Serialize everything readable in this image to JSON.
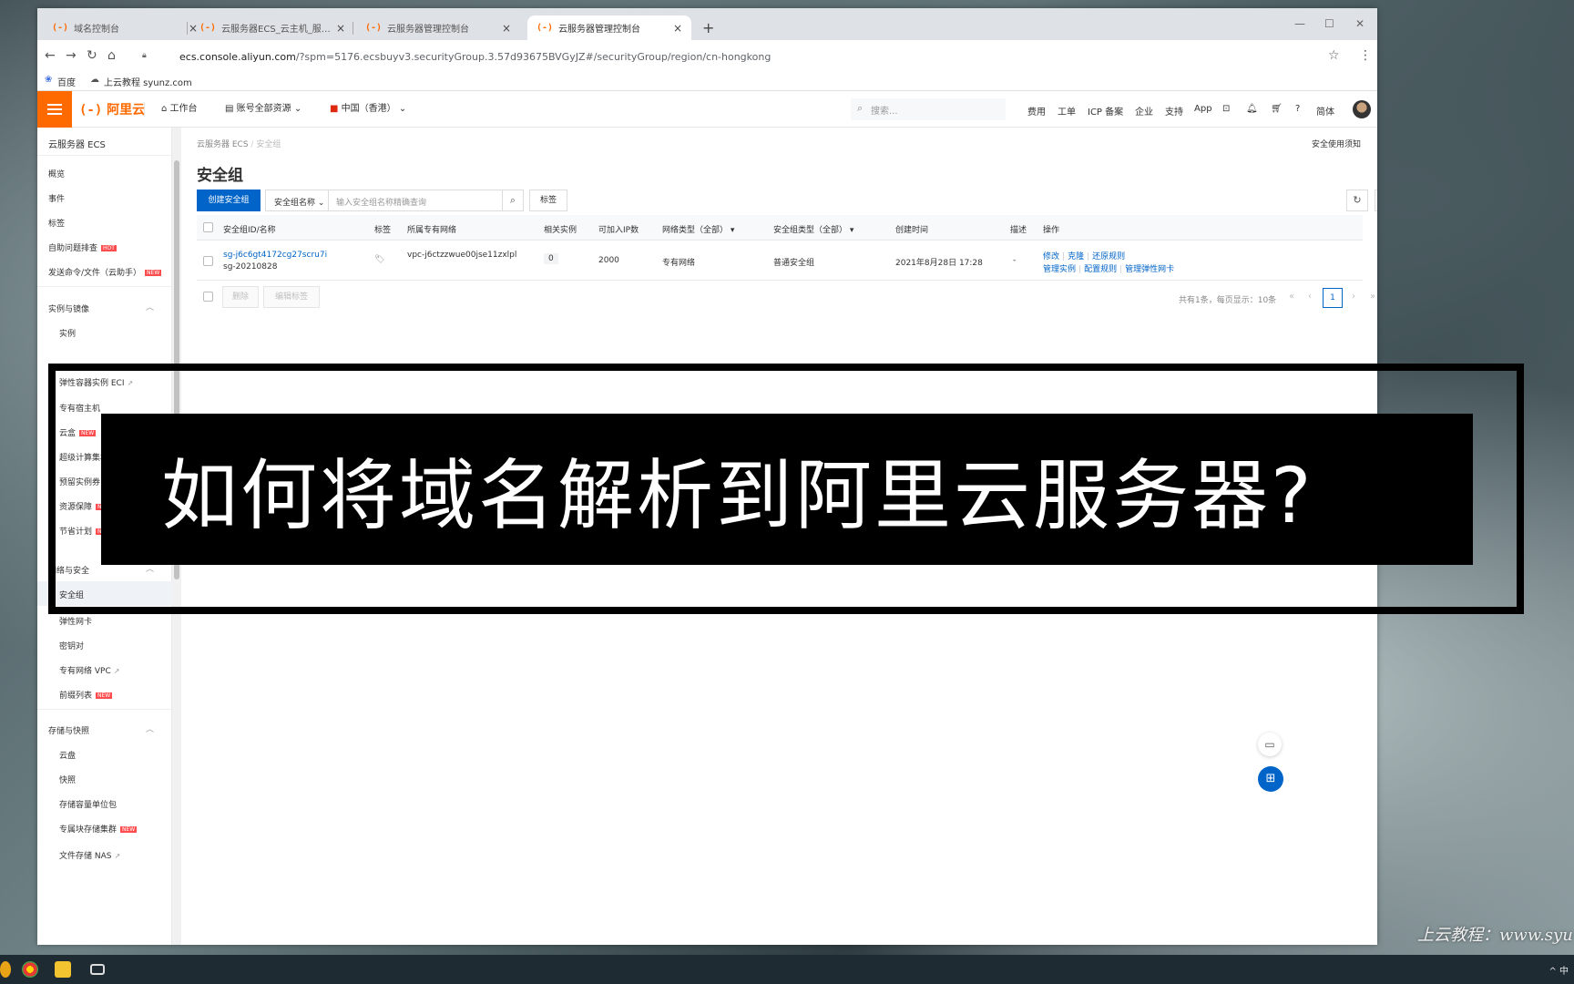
{
  "browser": {
    "tabs": [
      {
        "title": "域名控制台",
        "favicon": "(-)"
      },
      {
        "title": "云服务器ECS_云主机_服务器托管",
        "favicon": "(-)"
      },
      {
        "title": "云服务器管理控制台",
        "favicon": "(-)"
      },
      {
        "title": "云服务器管理控制台",
        "favicon": "(-)",
        "active": true
      }
    ],
    "url_host": "ecs.console.aliyun.com",
    "url_rest": "/?spm=5176.ecsbuyv3.securityGroup.3.57d93675BVGyJZ#/securityGroup/region/cn-hongkong",
    "bookmarks": [
      "百度",
      "上云教程 syunz.com"
    ]
  },
  "header": {
    "logo": "阿里云",
    "workbench": "工作台",
    "account_resources": "账号全部资源",
    "region": "中国（香港）",
    "search_placeholder": "搜索...",
    "links": [
      "费用",
      "工单",
      "ICP 备案",
      "企业",
      "支持",
      "App"
    ],
    "lang": "简体"
  },
  "sidebar": {
    "title": "云服务器 ECS",
    "top_items": [
      {
        "label": "概览"
      },
      {
        "label": "事件"
      },
      {
        "label": "标签"
      },
      {
        "label": "自助问题排查",
        "badge": "HOT"
      },
      {
        "label": "发送命令/文件（云助手）",
        "badge": "NEW"
      }
    ],
    "group1": {
      "title": "实例与镜像",
      "items": [
        {
          "label": "实例"
        }
      ]
    },
    "hidden_items": [
      {
        "label": "弹性容器实例 ECI",
        "ext": true
      },
      {
        "label": "专有宿主机"
      },
      {
        "label": "云盒",
        "badge": "NEW"
      },
      {
        "label": "超级计算集群"
      },
      {
        "label": "预留实例券"
      },
      {
        "label": "资源保障",
        "badge": "NEW"
      },
      {
        "label": "节省计划",
        "badge": "NEW"
      }
    ],
    "group2": {
      "title": "网络与安全",
      "items": [
        {
          "label": "安全组",
          "active": true
        },
        {
          "label": "弹性网卡"
        },
        {
          "label": "密钥对"
        },
        {
          "label": "专有网络 VPC",
          "ext": true
        },
        {
          "label": "前缀列表",
          "badge": "NEW"
        }
      ]
    },
    "group3": {
      "title": "存储与快照",
      "items": [
        {
          "label": "云盘"
        },
        {
          "label": "快照"
        },
        {
          "label": "存储容量单位包"
        },
        {
          "label": "专属块存储集群",
          "badge": "NEW"
        },
        {
          "label": "文件存储 NAS",
          "ext": true
        }
      ]
    }
  },
  "main": {
    "breadcrumb_root": "云服务器 ECS",
    "breadcrumb_current": "安全组",
    "help_link": "安全使用须知",
    "title": "安全组",
    "create_button": "创建安全组",
    "filter_select": "安全组名称",
    "filter_placeholder": "输入安全组名称精确查询",
    "tag_button": "标签",
    "columns": {
      "id_name": "安全组ID/名称",
      "tag": "标签",
      "vpc": "所属专有网络",
      "instances": "相关实例",
      "ip_count": "可加入IP数",
      "net_type": "网络类型（全部）",
      "sg_type": "安全组类型（全部）",
      "created": "创建时间",
      "desc": "描述",
      "ops": "操作"
    },
    "row": {
      "id": "sg-j6c6gt4172cg27scru7i",
      "name": "sg-20210828",
      "vpc": "vpc-j6ctzzwue00jse11zxlpl",
      "instances": "0",
      "ip_count": "2000",
      "net_type": "专有网络",
      "sg_type": "普通安全组",
      "created": "2021年8月28日 17:28",
      "desc": "-",
      "ops_line1": [
        "修改",
        "克隆",
        "还原规则"
      ],
      "ops_line2": [
        "管理实例",
        "配置规则",
        "管理弹性网卡"
      ]
    },
    "delete_button": "删除",
    "edit_tag_button": "编辑标签",
    "pager_info": "共有1条，每页显示：10条",
    "current_page": "1"
  },
  "overlay": {
    "caption": "如何将域名解析到阿里云服务器?"
  },
  "watermark": "上云教程：www.syu",
  "taskbar": {
    "tray": "^ 中"
  },
  "colors": {
    "brand_orange": "#ff6a00",
    "primary_blue": "#0064c8",
    "badge_red": "#ff4d4f"
  }
}
